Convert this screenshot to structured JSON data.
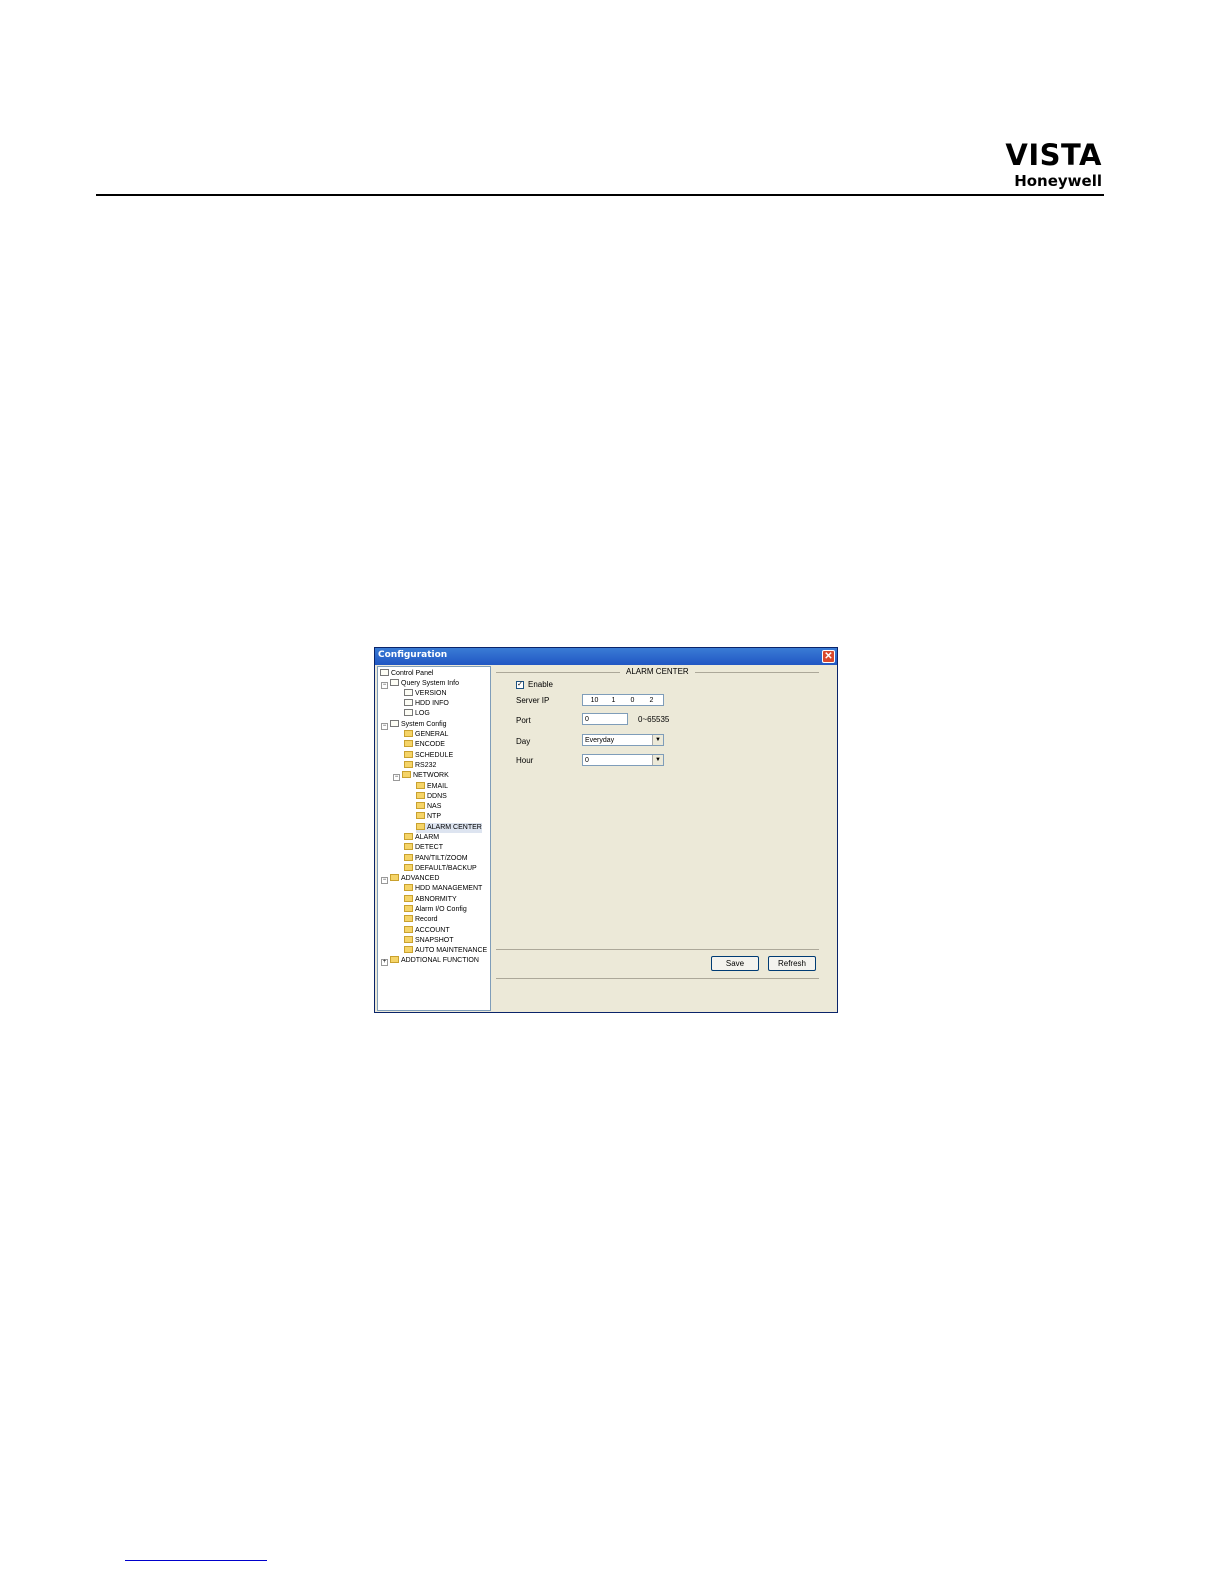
{
  "header": {
    "brand_name": "VISTA",
    "brand_sub": "Honeywell"
  },
  "window": {
    "title": "Configuration"
  },
  "tree": [
    {
      "label": "Control Panel"
    },
    {
      "label": "Query System Info"
    },
    {
      "label": "VERSION"
    },
    {
      "label": "HDD INFO"
    },
    {
      "label": "LOG"
    },
    {
      "label": "System Config"
    },
    {
      "label": "GENERAL"
    },
    {
      "label": "ENCODE"
    },
    {
      "label": "SCHEDULE"
    },
    {
      "label": "RS232"
    },
    {
      "label": "NETWORK"
    },
    {
      "label": "EMAIL"
    },
    {
      "label": "DDNS"
    },
    {
      "label": "NAS"
    },
    {
      "label": "NTP"
    },
    {
      "label": "ALARM CENTER"
    },
    {
      "label": "ALARM"
    },
    {
      "label": "DETECT"
    },
    {
      "label": "PAN/TILT/ZOOM"
    },
    {
      "label": "DEFAULT/BACKUP"
    },
    {
      "label": "ADVANCED"
    },
    {
      "label": "HDD MANAGEMENT"
    },
    {
      "label": "ABNORMITY"
    },
    {
      "label": "Alarm I/O Config"
    },
    {
      "label": "Record"
    },
    {
      "label": "ACCOUNT"
    },
    {
      "label": "SNAPSHOT"
    },
    {
      "label": "AUTO MAINTENANCE"
    },
    {
      "label": "ADDTIONAL FUNCTION"
    }
  ],
  "panel": {
    "title": "ALARM CENTER",
    "enable_label": "Enable",
    "enable_checked": true,
    "enable_mark": "✓",
    "server_ip_label": "Server IP",
    "server_ip": [
      "10",
      "1",
      "0",
      "2"
    ],
    "port_label": "Port",
    "port_value": "0",
    "port_range": "0~65535",
    "day_label": "Day",
    "day_value": "Everyday",
    "hour_label": "Hour",
    "hour_value": "0",
    "save_label": "Save",
    "refresh_label": "Refresh"
  }
}
